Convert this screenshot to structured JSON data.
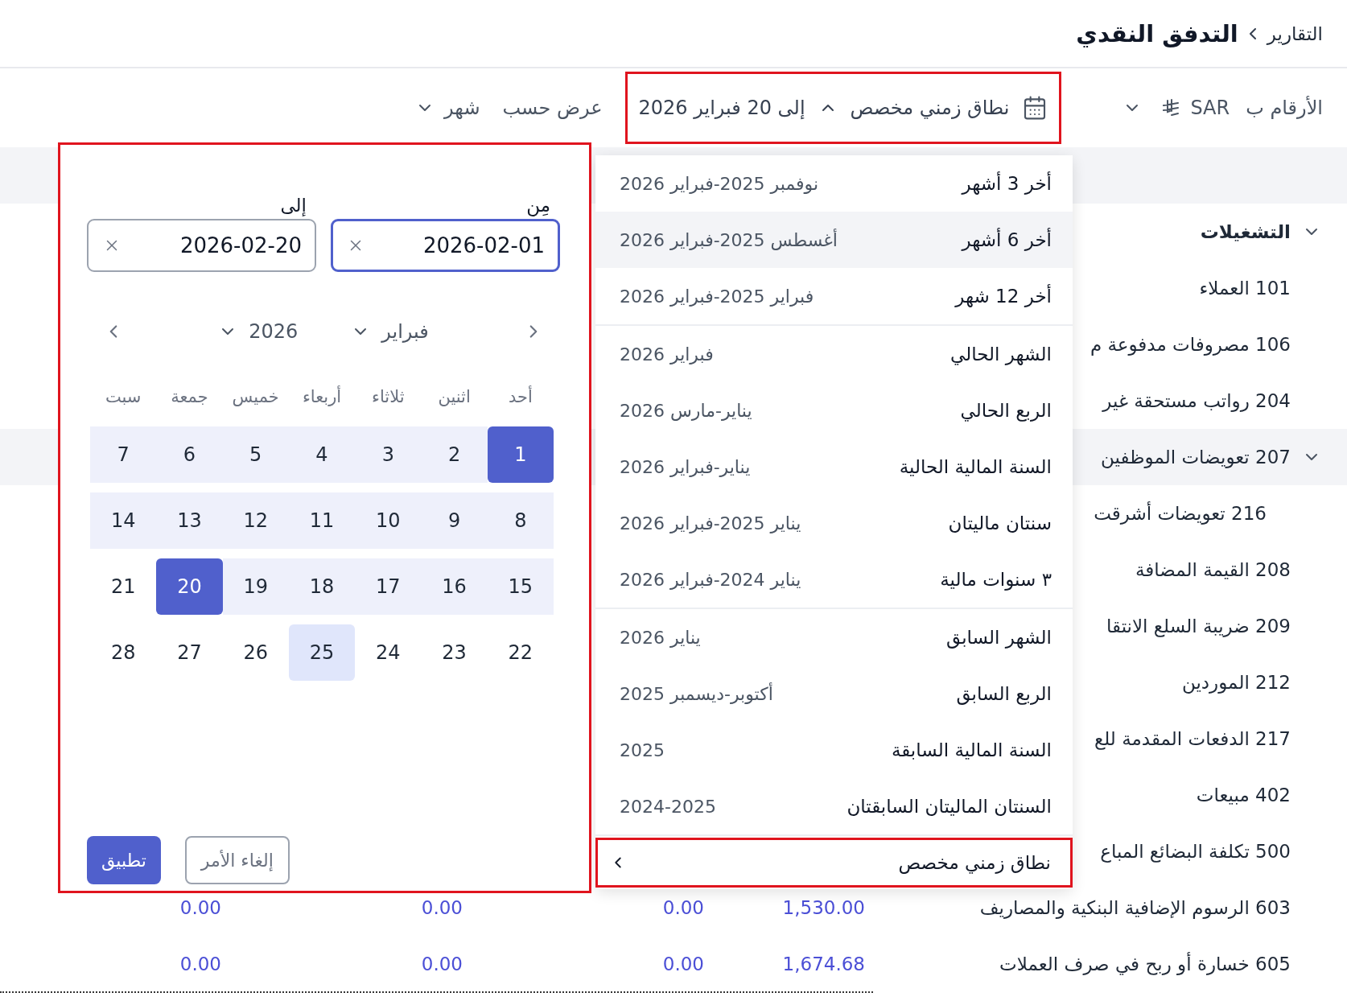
{
  "breadcrumb": {
    "parent": "التقارير",
    "current": "التدفق النقدي"
  },
  "toolbar": {
    "amounts_label": "الأرقام ب",
    "currency": "SAR",
    "range_button": {
      "label": "نطاق زمني مخصص",
      "value": "إلى 20 فبراير 2026",
      "expanded": true
    },
    "view_label": "عرض حسب",
    "view_value": "شهر"
  },
  "table": {
    "rows": [
      {
        "label": "التشغيلات",
        "kind": "section",
        "expanded": true,
        "values": []
      },
      {
        "label": "101 العملاء",
        "kind": "account",
        "expanded": false,
        "values": []
      },
      {
        "label": "106 مصروفات مدفوعة م",
        "kind": "account",
        "expanded": false,
        "values": []
      },
      {
        "label": "204 رواتب مستحقة غير",
        "kind": "account",
        "expanded": false,
        "values": []
      },
      {
        "label": "207 تعويضات الموظفين",
        "kind": "group",
        "expanded": true,
        "values": []
      },
      {
        "label": "216 تعويضات أشرقت",
        "kind": "sub_account",
        "expanded": false,
        "values": []
      },
      {
        "label": "208 القيمة المضافة",
        "kind": "account",
        "expanded": false,
        "values": []
      },
      {
        "label": "209 ضريبة السلع الانتقا",
        "kind": "account",
        "expanded": false,
        "values": []
      },
      {
        "label": "212 الموردين",
        "kind": "account",
        "expanded": false,
        "values": []
      },
      {
        "label": "217 الدفعات المقدمة للع",
        "kind": "account",
        "expanded": false,
        "values": []
      },
      {
        "label": "402 مبيعات",
        "kind": "account",
        "expanded": false,
        "values": []
      },
      {
        "label": "500 تكلفة البضائع المباع",
        "kind": "account",
        "expanded": false,
        "values": []
      },
      {
        "label": "603 الرسوم الإضافية البنكية والمصاريف",
        "kind": "account",
        "expanded": false,
        "values": [
          "1,530.00",
          "0.00",
          "0.00",
          "0.00"
        ]
      },
      {
        "label": "605 خسارة أو ربح في صرف العملات",
        "kind": "account",
        "expanded": false,
        "values": [
          "1,674.68",
          "0.00",
          "0.00",
          "0.00"
        ]
      }
    ]
  },
  "presets": {
    "groups": [
      {
        "items": [
          {
            "label": "أخر 3 أشهر",
            "range": "نوفمبر 2025-فبراير 2026",
            "selected": false
          },
          {
            "label": "أخر 6 أشهر",
            "range": "أغسطس 2025-فبراير 2026",
            "selected": true
          },
          {
            "label": "أخر 12 شهر",
            "range": "فبراير 2025-فبراير 2026",
            "selected": false
          }
        ]
      },
      {
        "items": [
          {
            "label": "الشهر الحالي",
            "range": "فبراير 2026",
            "selected": false
          },
          {
            "label": "الربع الحالي",
            "range": "يناير-مارس 2026",
            "selected": false
          },
          {
            "label": "السنة المالية الحالية",
            "range": "يناير-فبراير 2026",
            "selected": false
          },
          {
            "label": "سنتان ماليتان",
            "range": "يناير 2025-فبراير 2026",
            "selected": false
          },
          {
            "label": "٣ سنوات مالية",
            "range": "يناير 2024-فبراير 2026",
            "selected": false
          }
        ]
      },
      {
        "items": [
          {
            "label": "الشهر السابق",
            "range": "يناير 2026",
            "selected": false
          },
          {
            "label": "الربع السابق",
            "range": "أكتوبر-ديسمبر 2025",
            "selected": false
          },
          {
            "label": "السنة المالية السابقة",
            "range": "2025",
            "selected": false
          },
          {
            "label": "السنتان الماليتان السابقتان",
            "range": "2024-2025",
            "selected": false
          }
        ]
      }
    ],
    "custom": {
      "label": "نطاق زمني مخصص"
    }
  },
  "calendar": {
    "from": {
      "label": "مِن",
      "value": "2026-02-01",
      "focused": true
    },
    "to": {
      "label": "إلى",
      "value": "2026-02-20",
      "focused": false
    },
    "month": "فبراير",
    "year": "2026",
    "weekdays": [
      "أحد",
      "اثنين",
      "ثلاثاء",
      "أربعاء",
      "خميس",
      "جمعة",
      "سبت"
    ],
    "days": [
      {
        "label": "1",
        "selected": true,
        "in_range": true,
        "today": false
      },
      {
        "label": "2",
        "selected": false,
        "in_range": true,
        "today": false
      },
      {
        "label": "3",
        "selected": false,
        "in_range": true,
        "today": false
      },
      {
        "label": "4",
        "selected": false,
        "in_range": true,
        "today": false
      },
      {
        "label": "5",
        "selected": false,
        "in_range": true,
        "today": false
      },
      {
        "label": "6",
        "selected": false,
        "in_range": true,
        "today": false
      },
      {
        "label": "7",
        "selected": false,
        "in_range": true,
        "today": false
      },
      {
        "label": "8",
        "selected": false,
        "in_range": true,
        "today": false
      },
      {
        "label": "9",
        "selected": false,
        "in_range": true,
        "today": false
      },
      {
        "label": "10",
        "selected": false,
        "in_range": true,
        "today": false
      },
      {
        "label": "11",
        "selected": false,
        "in_range": true,
        "today": false
      },
      {
        "label": "12",
        "selected": false,
        "in_range": true,
        "today": false
      },
      {
        "label": "13",
        "selected": false,
        "in_range": true,
        "today": false
      },
      {
        "label": "14",
        "selected": false,
        "in_range": true,
        "today": false
      },
      {
        "label": "15",
        "selected": false,
        "in_range": true,
        "today": false
      },
      {
        "label": "16",
        "selected": false,
        "in_range": true,
        "today": false
      },
      {
        "label": "17",
        "selected": false,
        "in_range": true,
        "today": false
      },
      {
        "label": "18",
        "selected": false,
        "in_range": true,
        "today": false
      },
      {
        "label": "19",
        "selected": false,
        "in_range": true,
        "today": false
      },
      {
        "label": "20",
        "selected": true,
        "in_range": true,
        "today": false
      },
      {
        "label": "21",
        "selected": false,
        "in_range": false,
        "today": false
      },
      {
        "label": "22",
        "selected": false,
        "in_range": false,
        "today": false
      },
      {
        "label": "23",
        "selected": false,
        "in_range": false,
        "today": false
      },
      {
        "label": "24",
        "selected": false,
        "in_range": false,
        "today": false
      },
      {
        "label": "25",
        "selected": false,
        "in_range": false,
        "today": true
      },
      {
        "label": "26",
        "selected": false,
        "in_range": false,
        "today": false
      },
      {
        "label": "27",
        "selected": false,
        "in_range": false,
        "today": false
      },
      {
        "label": "28",
        "selected": false,
        "in_range": false,
        "today": false
      }
    ],
    "cancel": "إلغاء الأمر",
    "apply": "تطبيق"
  }
}
